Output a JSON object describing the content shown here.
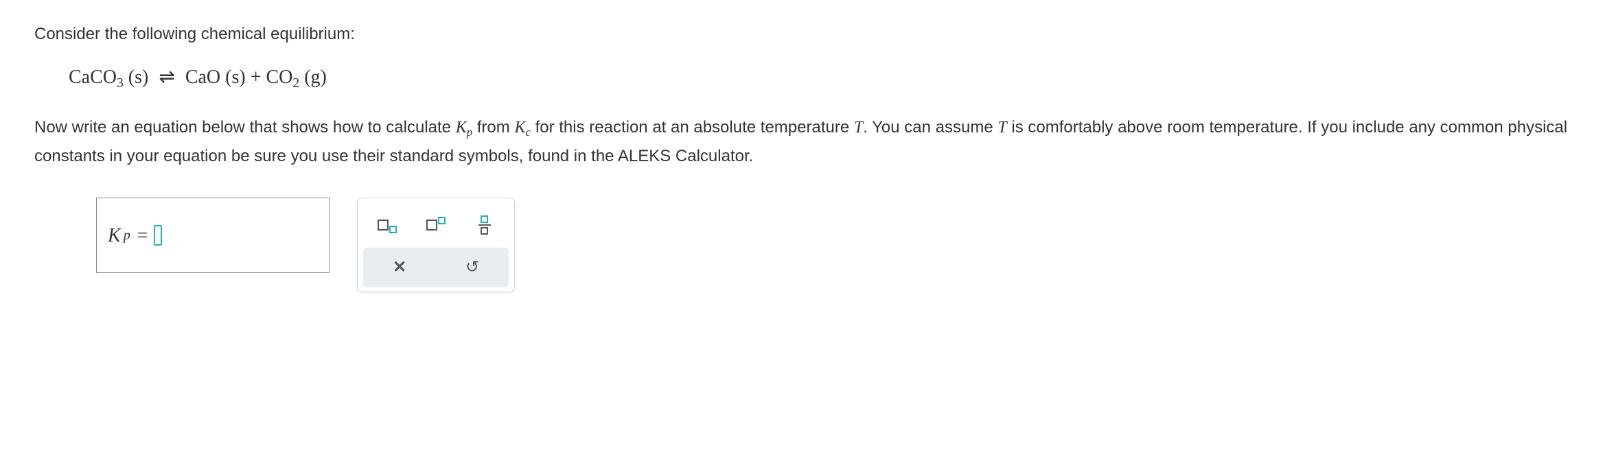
{
  "intro": "Consider the following chemical equilibrium:",
  "equation": {
    "lhs_formula": "CaCO",
    "lhs_sub": "3",
    "lhs_state": "(s)",
    "arrow": "⇌",
    "rhs1_formula": "CaO",
    "rhs1_state": "(s)",
    "plus": "+",
    "rhs2_formula": "CO",
    "rhs2_sub": "2",
    "rhs2_state": "(g)"
  },
  "prompt_pre": "Now write an equation below that shows how to calculate ",
  "Kp_base": "K",
  "Kp_sub": "p",
  "prompt_mid1": " from ",
  "Kc_base": "K",
  "Kc_sub": "c",
  "prompt_mid2": " for this reaction at an absolute temperature ",
  "T_var": "T",
  "prompt_mid3": ". You can assume ",
  "prompt_mid4": " is comfortably above room temperature. If you include any common physical constants in your equation be sure you use their standard symbols, found in the ALEKS Calculator.",
  "answer": {
    "lhs_base": "K",
    "lhs_sub": "p",
    "equals": "="
  },
  "palette": {
    "sub_tmpl": "subscript",
    "sup_tmpl": "superscript",
    "frac_tmpl": "fraction",
    "clear": "clear",
    "undo": "undo"
  }
}
